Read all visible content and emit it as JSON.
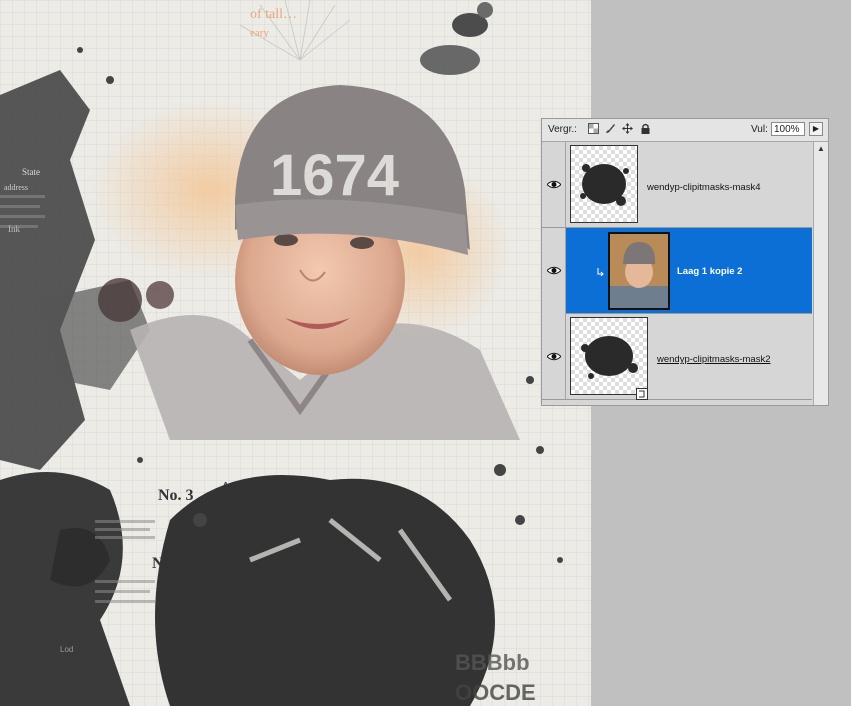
{
  "canvas": {
    "header_text_1": "of tall…",
    "header_text_2": "eary",
    "stamp_no3": "No. 3",
    "stamp_no4": "No. 4",
    "stamp_aaa": "AAA",
    "bottom_letters_1": "BBBbb",
    "bottom_letters_2": "OOCDE",
    "side_text_1": "State",
    "side_text_2": "address",
    "side_text_3": "Ink",
    "side_text_4": "Lod",
    "hat_number": "1674"
  },
  "layers_panel": {
    "lock_label": "Vergr.:",
    "opacity_label": "Vul:",
    "opacity_value": "100%",
    "flyout_glyph": "▶",
    "scroll_up_glyph": "▲",
    "lock_icons": [
      "lock-transparent-icon",
      "lock-brush-icon",
      "lock-move-icon",
      "lock-all-icon"
    ],
    "layers": [
      {
        "name": "wendyp-clipitmasks-mask4",
        "selected": false,
        "visible": true
      },
      {
        "name": "Laag 1 kopie 2",
        "selected": true,
        "visible": true,
        "clipped": true
      },
      {
        "name": "wendyp-clipitmasks-mask2",
        "selected": false,
        "visible": true,
        "linked": true
      }
    ]
  },
  "colors": {
    "selection": "#0c6fd6",
    "panel_bg": "#d6d6d6",
    "workspace": "#c0c0c0"
  }
}
